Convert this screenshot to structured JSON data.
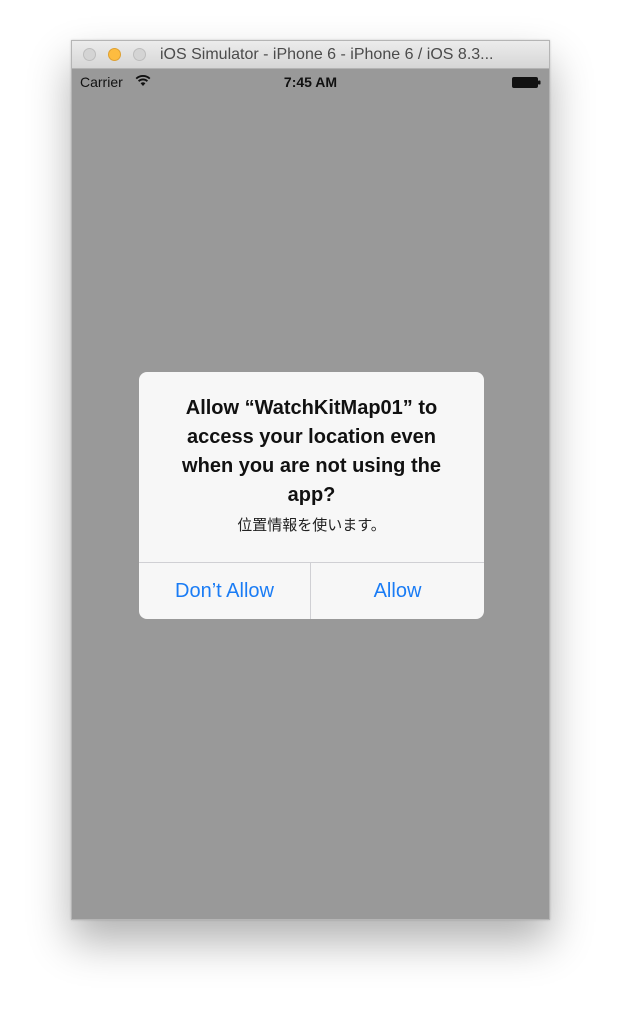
{
  "window": {
    "title": "iOS Simulator - iPhone 6 - iPhone 6 / iOS 8.3..."
  },
  "status_bar": {
    "carrier": "Carrier",
    "time": "7:45 AM",
    "icons": [
      "wifi-icon",
      "battery-icon"
    ]
  },
  "alert": {
    "title": "Allow “WatchKitMap01” to access your location even when you are not using the app?",
    "message": "位置情報を使います。",
    "buttons": {
      "dont_allow": "Don’t Allow",
      "allow": "Allow"
    }
  },
  "colors": {
    "screen_background": "#999999",
    "alert_background": "#f7f7f7",
    "button_text": "#1a7cf5",
    "minimize_button": "#fdbc40"
  }
}
